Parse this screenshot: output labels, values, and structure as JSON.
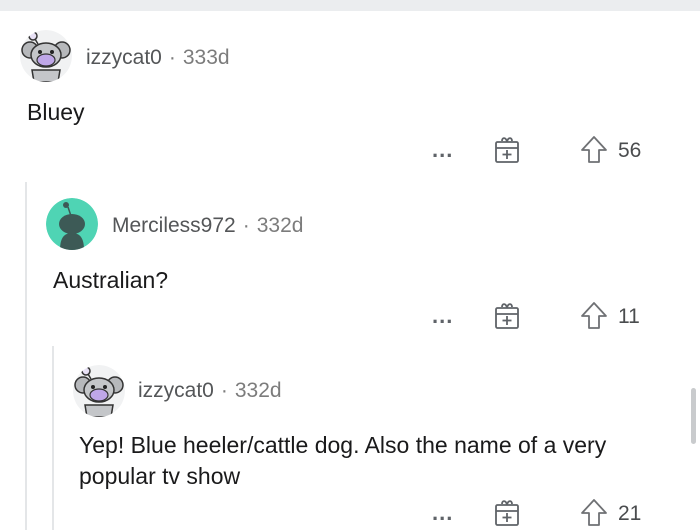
{
  "comments": [
    {
      "username": "izzycat0",
      "separator": "·",
      "age": "333d",
      "text": "Bluey",
      "more_label": "...",
      "upvotes": "56",
      "avatar": "snoo-koala-avatar"
    },
    {
      "username": "Merciless972",
      "separator": "·",
      "age": "332d",
      "text": "Australian?",
      "more_label": "...",
      "upvotes": "11",
      "avatar": "default-snoo-avatar"
    },
    {
      "username": "izzycat0",
      "separator": "·",
      "age": "332d",
      "text": "Yep! Blue heeler/cattle dog. Also the name of a very popular tv show",
      "more_label": "...",
      "upvotes": "21",
      "avatar": "snoo-koala-avatar"
    }
  ],
  "colors": {
    "thread_line": "#e4e6e8",
    "meta_text": "#7c7c7c",
    "default_avatar_bg": "#4fd4b4"
  }
}
